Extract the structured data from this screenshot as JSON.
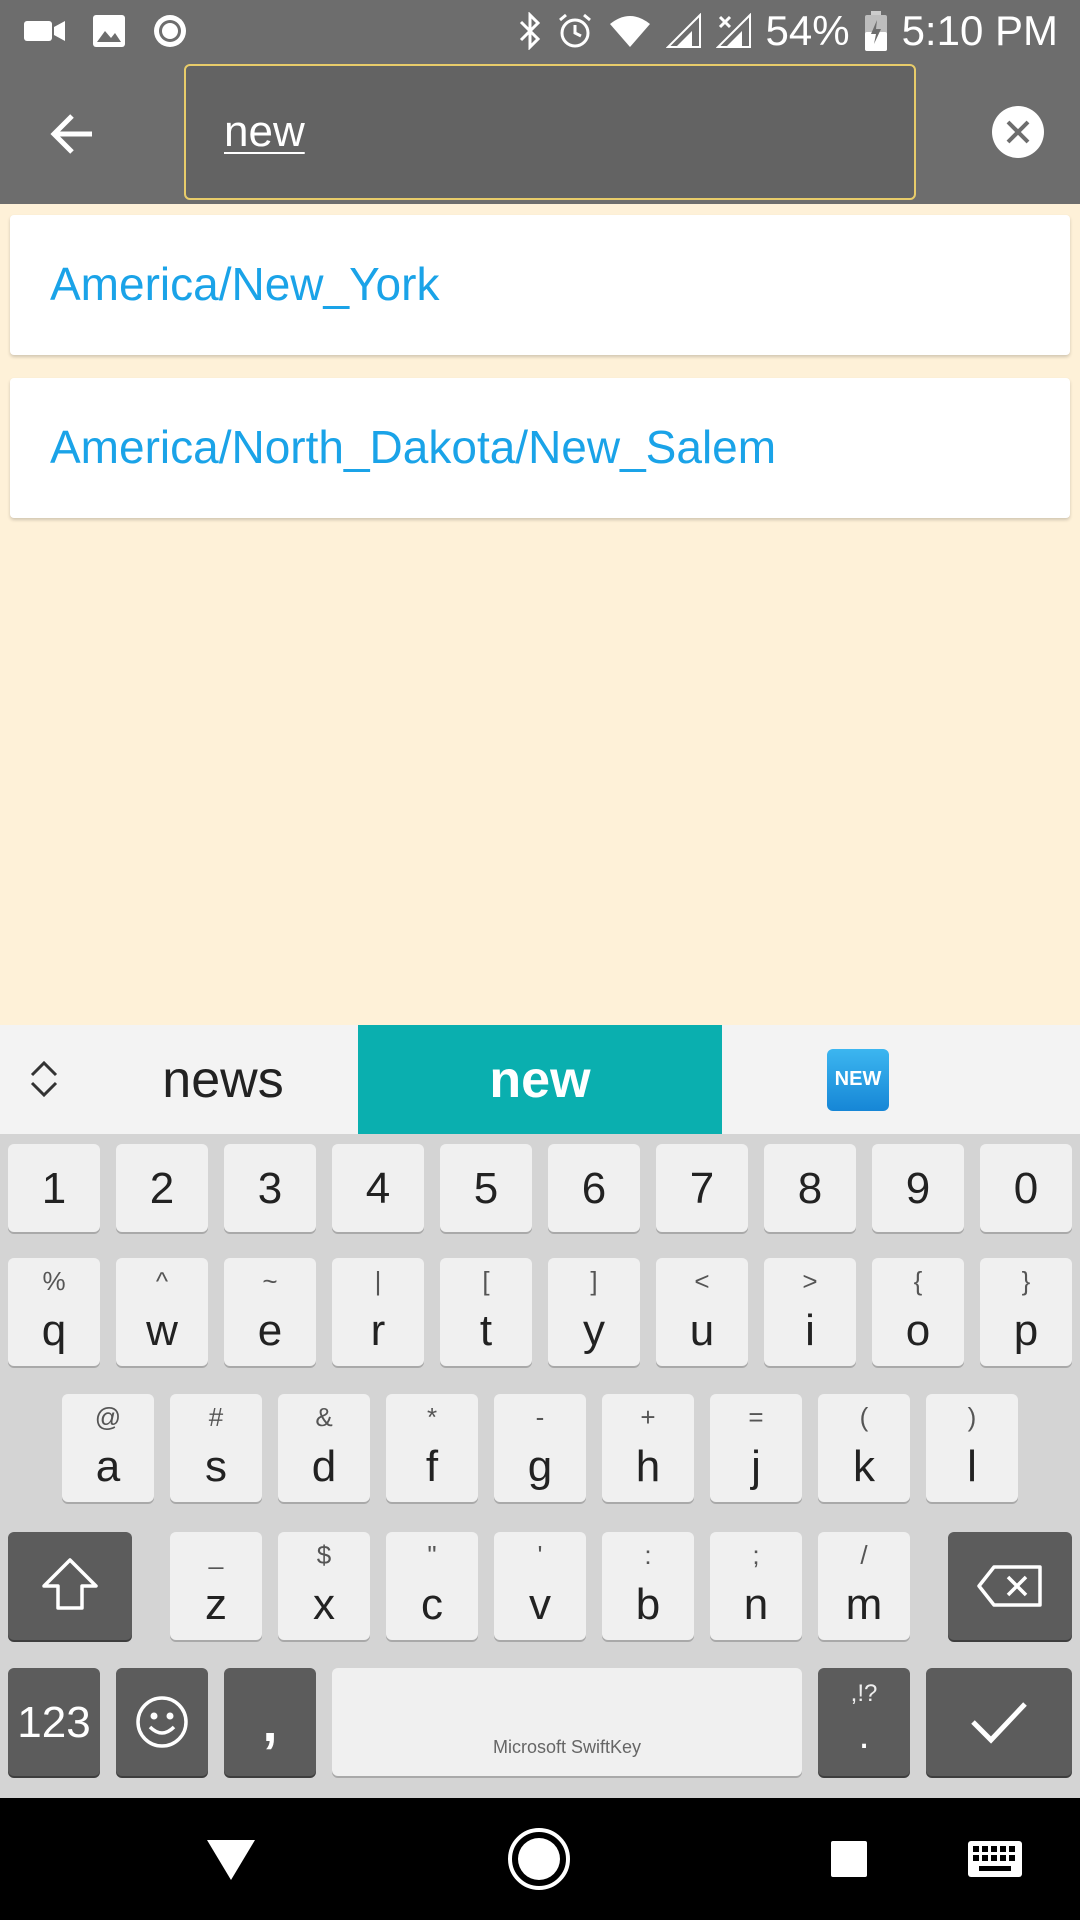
{
  "status_bar": {
    "left_icons": [
      "video-camera-icon",
      "image-icon",
      "record-icon"
    ],
    "right_icons": [
      "bluetooth-icon",
      "alarm-icon",
      "wifi-icon",
      "cell-signal-icon",
      "cell-signal-x-icon"
    ],
    "battery_percent": "54%",
    "time": "5:10 PM"
  },
  "app_bar": {
    "back_icon": "arrow-back-icon",
    "search_value": "new",
    "clear_icon": "clear-icon"
  },
  "results": [
    {
      "label": "America/New_York"
    },
    {
      "label": "America/North_Dakota/New_Salem"
    }
  ],
  "suggestions": {
    "expand_icon": "chevron-up-down-icon",
    "items": [
      "news",
      "new"
    ],
    "emoji_label": "NEW"
  },
  "keyboard": {
    "number_row": [
      "1",
      "2",
      "3",
      "4",
      "5",
      "6",
      "7",
      "8",
      "9",
      "0"
    ],
    "row1": [
      {
        "main": "q",
        "sub": "%"
      },
      {
        "main": "w",
        "sub": "^"
      },
      {
        "main": "e",
        "sub": "~"
      },
      {
        "main": "r",
        "sub": "|"
      },
      {
        "main": "t",
        "sub": "["
      },
      {
        "main": "y",
        "sub": "]"
      },
      {
        "main": "u",
        "sub": "<"
      },
      {
        "main": "i",
        "sub": ">"
      },
      {
        "main": "o",
        "sub": "{"
      },
      {
        "main": "p",
        "sub": "}"
      }
    ],
    "row2": [
      {
        "main": "a",
        "sub": "@"
      },
      {
        "main": "s",
        "sub": "#"
      },
      {
        "main": "d",
        "sub": "&"
      },
      {
        "main": "f",
        "sub": "*"
      },
      {
        "main": "g",
        "sub": "-"
      },
      {
        "main": "h",
        "sub": "+"
      },
      {
        "main": "j",
        "sub": "="
      },
      {
        "main": "k",
        "sub": "("
      },
      {
        "main": "l",
        "sub": ")"
      }
    ],
    "row3": [
      {
        "main": "z",
        "sub": "_"
      },
      {
        "main": "x",
        "sub": "$"
      },
      {
        "main": "c",
        "sub": "\""
      },
      {
        "main": "v",
        "sub": "'"
      },
      {
        "main": "b",
        "sub": ":"
      },
      {
        "main": "n",
        "sub": ";"
      },
      {
        "main": "m",
        "sub": "/"
      }
    ],
    "shift_icon": "shift-icon",
    "backspace_icon": "backspace-icon",
    "numbers_label": "123",
    "emoji_icon": "smiley-icon",
    "comma": ",",
    "space_brand": "Microsoft SwiftKey",
    "period_main": ".",
    "period_sub": ",!?",
    "enter_icon": "checkmark-icon"
  },
  "nav_bar": {
    "back_icon": "nav-back-triangle-icon",
    "home_icon": "nav-home-circle-icon",
    "recents_icon": "nav-recents-square-icon",
    "keyboard_icon": "keyboard-icon"
  }
}
